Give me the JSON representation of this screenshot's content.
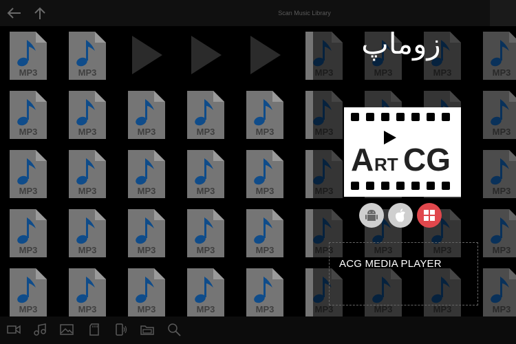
{
  "header": {
    "title": "Scan Music Library",
    "back_icon": "back-arrow-icon",
    "up_icon": "up-arrow-icon"
  },
  "grid": {
    "file_label": "MP3",
    "rows": 5,
    "cols": 9,
    "placeholder_cells": [
      [
        0,
        2
      ],
      [
        0,
        3
      ],
      [
        0,
        4
      ]
    ],
    "colors": {
      "file": "#757575",
      "fold": "#9a9a9a",
      "note": "#0f4c8a",
      "label": "#3f3f3f",
      "play": "#2b2b2b"
    }
  },
  "toolbar": {
    "icons": [
      "video-icon",
      "music-icon",
      "image-icon",
      "sd-card-icon",
      "phone-media-icon",
      "folder-icon",
      "search-icon"
    ]
  },
  "ad": {
    "brand_persian": "زوماپ",
    "logo_text_a": "A",
    "logo_text_rt": "RT",
    "logo_text_cg": "CG",
    "platforms": [
      "android-icon",
      "apple-icon",
      "windows-icon"
    ],
    "product_name": "ACG MEDIA PLAYER"
  }
}
